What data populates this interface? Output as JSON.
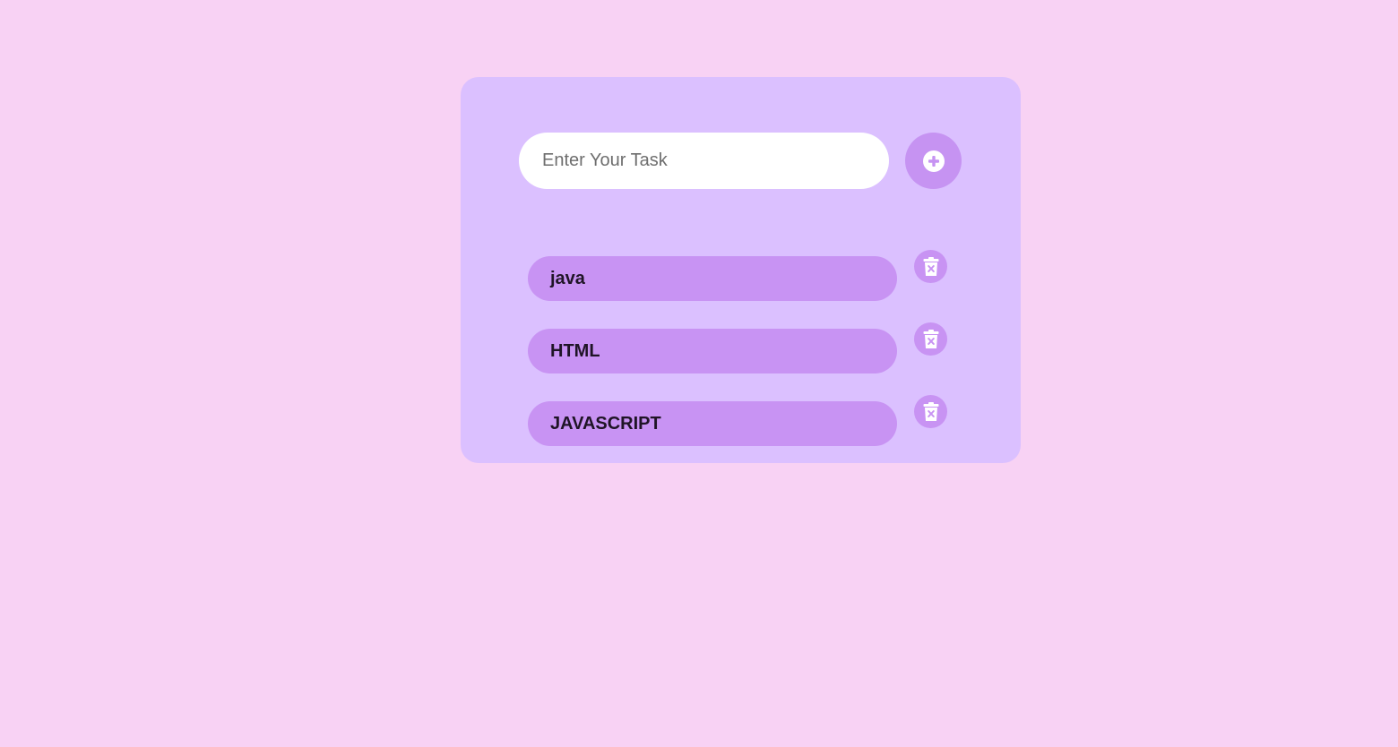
{
  "input": {
    "placeholder": "Enter Your Task",
    "value": ""
  },
  "add_button": {
    "icon": "plus-circle-icon"
  },
  "tasks": [
    {
      "label": "java",
      "delete_icon": "trash-x-icon"
    },
    {
      "label": "HTML",
      "delete_icon": "trash-x-icon"
    },
    {
      "label": "JAVASCRIPT",
      "delete_icon": "trash-x-icon"
    }
  ],
  "colors": {
    "background": "#f8d2f4",
    "card": "#dbc0ff",
    "accent": "#c893f3",
    "input": "#ffffff"
  }
}
